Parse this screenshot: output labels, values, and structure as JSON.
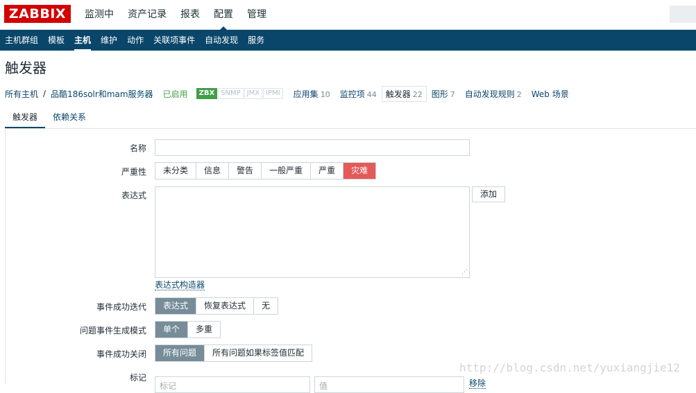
{
  "logo": "ZABBIX",
  "main_nav": [
    "监测中",
    "资产记录",
    "报表",
    "配置",
    "管理"
  ],
  "sub_nav": [
    "主机群组",
    "模板",
    "主机",
    "维护",
    "动作",
    "关联项事件",
    "自动发现",
    "服务"
  ],
  "page_title": "触发器",
  "breadcrumb": {
    "all_hosts": "所有主机",
    "separator": "/",
    "host": "品酷186solr和mam服务器",
    "status": "已启用",
    "availability": [
      "ZBX",
      "SNMP",
      "JMX",
      "IPMI"
    ],
    "links": [
      {
        "label": "应用集",
        "count": "10"
      },
      {
        "label": "监控项",
        "count": "44"
      },
      {
        "label": "触发器",
        "count": "22"
      },
      {
        "label": "图形",
        "count": "7"
      },
      {
        "label": "自动发现规则",
        "count": "2"
      },
      {
        "label": "Web 场景",
        "count": ""
      }
    ]
  },
  "tabs": [
    "触发器",
    "依赖关系"
  ],
  "form": {
    "name_label": "名称",
    "severity_label": "严重性",
    "severity_options": [
      "未分类",
      "信息",
      "警告",
      "一般严重",
      "严重",
      "灾难"
    ],
    "expression_label": "表达式",
    "add_button": "添加",
    "expression_builder": "表达式构造器",
    "ok_event_label": "事件成功迭代",
    "ok_event_options": [
      "表达式",
      "恢复表达式",
      "无"
    ],
    "problem_mode_label": "问题事件生成模式",
    "problem_mode_options": [
      "单个",
      "多重"
    ],
    "ok_close_label": "事件成功关闭",
    "ok_close_options": [
      "所有问题",
      "所有问题如果标签值匹配"
    ],
    "tags_label": "标记",
    "tag_placeholder": "标记",
    "value_placeholder": "值",
    "remove_link": "移除"
  },
  "watermark": "http://blog.csdn.net/yuxiangjie12"
}
